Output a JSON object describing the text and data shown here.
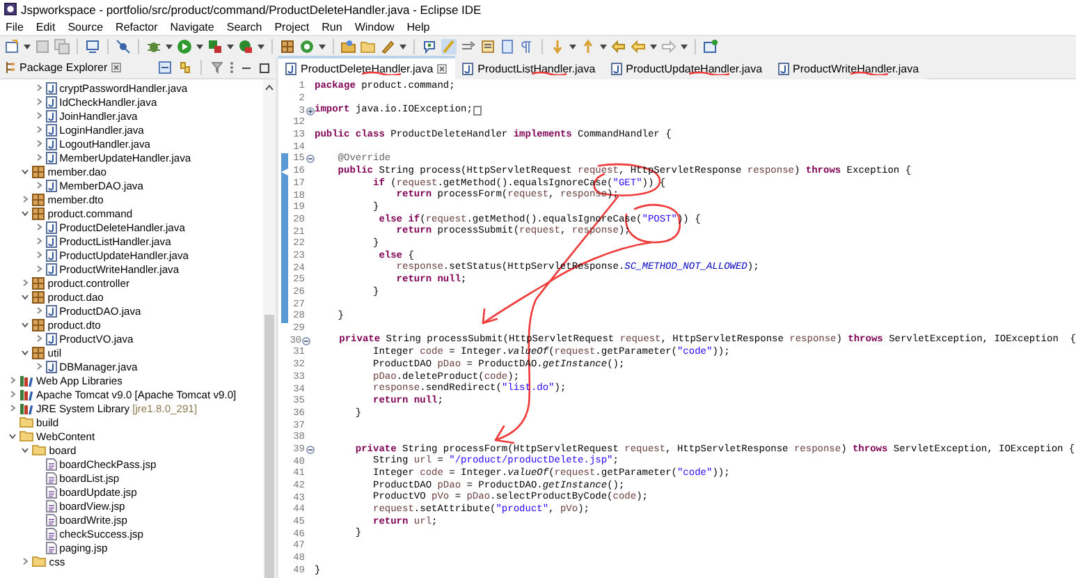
{
  "window": {
    "title": "Jspworkspace - portfolio/src/product/command/ProductDeleteHandler.java - Eclipse IDE"
  },
  "menu": [
    "File",
    "Edit",
    "Source",
    "Refactor",
    "Navigate",
    "Search",
    "Project",
    "Run",
    "Window",
    "Help"
  ],
  "explorer": {
    "title": "Package Explorer",
    "tree": [
      {
        "children": [
          {
            "children": [
              {
                "label": "cryptPasswordHandler.java",
                "kind": "java",
                "expanded": false
              },
              {
                "label": "IdCheckHandler.java",
                "kind": "java",
                "expanded": false
              },
              {
                "label": "JoinHandler.java",
                "kind": "java",
                "expanded": false
              },
              {
                "label": "LoginHandler.java",
                "kind": "java",
                "expanded": false
              },
              {
                "label": "LogoutHandler.java",
                "kind": "java",
                "expanded": false
              },
              {
                "label": "MemberUpdateHandler.java",
                "kind": "java",
                "expanded": false
              }
            ]
          },
          {
            "label": "member.dao",
            "kind": "package",
            "expanded": true,
            "children": [
              {
                "label": "MemberDAO.java",
                "kind": "java",
                "expanded": false
              }
            ]
          },
          {
            "label": "member.dto",
            "kind": "package",
            "expanded": false
          },
          {
            "label": "product.command",
            "kind": "package",
            "expanded": true,
            "children": [
              {
                "label": "ProductDeleteHandler.java",
                "kind": "java",
                "expanded": false
              },
              {
                "label": "ProductListHandler.java",
                "kind": "java",
                "expanded": false
              },
              {
                "label": "ProductUpdateHandler.java",
                "kind": "java",
                "expanded": false
              },
              {
                "label": "ProductWriteHandler.java",
                "kind": "java",
                "expanded": false
              }
            ]
          },
          {
            "label": "product.controller",
            "kind": "package",
            "expanded": false
          },
          {
            "label": "product.dao",
            "kind": "package",
            "expanded": true,
            "children": [
              {
                "label": "ProductDAO.java",
                "kind": "java",
                "expanded": false
              }
            ]
          },
          {
            "label": "product.dto",
            "kind": "package",
            "expanded": true,
            "children": [
              {
                "label": "ProductVO.java",
                "kind": "java",
                "expanded": false
              }
            ]
          },
          {
            "label": "util",
            "kind": "package",
            "expanded": true,
            "children": [
              {
                "label": "DBManager.java",
                "kind": "java",
                "expanded": false
              }
            ]
          }
        ]
      },
      {
        "label": "Web App Libraries",
        "kind": "library",
        "expanded": false
      },
      {
        "label": "Apache Tomcat v9.0 [Apache Tomcat v9.0]",
        "kind": "library",
        "expanded": false
      },
      {
        "label": "JRE System Library",
        "decoration": "[jre1.8.0_291]",
        "kind": "library",
        "expanded": false
      },
      {
        "label": "build",
        "kind": "folder"
      },
      {
        "label": "WebContent",
        "kind": "folder",
        "expanded": true,
        "children": [
          {
            "label": "board",
            "kind": "folder",
            "expanded": true,
            "children": [
              {
                "label": "boardCheckPass.jsp",
                "kind": "jsp"
              },
              {
                "label": "boardList.jsp",
                "kind": "jsp"
              },
              {
                "label": "boardUpdate.jsp",
                "kind": "jsp"
              },
              {
                "label": "boardView.jsp",
                "kind": "jsp"
              },
              {
                "label": "boardWrite.jsp",
                "kind": "jsp"
              },
              {
                "label": "checkSuccess.jsp",
                "kind": "jsp"
              },
              {
                "label": "paging.jsp",
                "kind": "jsp"
              }
            ]
          },
          {
            "label": "css",
            "kind": "folder",
            "expanded": false
          }
        ]
      }
    ]
  },
  "editor": {
    "tabs": [
      {
        "label": "ProductDeleteHandler.java",
        "selected": true
      },
      {
        "label": "ProductListHandler.java",
        "selected": false
      },
      {
        "label": "ProductUpdateHandler.java",
        "selected": false
      },
      {
        "label": "ProductWriteHandler.java",
        "selected": false
      }
    ],
    "lines": [
      {
        "n": "1",
        "kind": "plain",
        "marked": false,
        "tokens": [
          {
            "kind": "keyword",
            "text": "package"
          },
          {
            "kind": "plain",
            "text": " product.command;"
          }
        ]
      },
      {
        "n": "2",
        "kind": "plain",
        "marked": false
      },
      {
        "n": "3",
        "kind": "folded",
        "marked": false,
        "tokens": [
          {
            "kind": "keyword",
            "text": "import"
          },
          {
            "kind": "plain",
            "text": " java.io.IOException;"
          }
        ]
      },
      {
        "n": "12",
        "kind": "plain",
        "marked": false
      },
      {
        "n": "13",
        "kind": "plain",
        "marked": false,
        "tokens": [
          {
            "kind": "keyword",
            "text": "public class"
          },
          {
            "kind": "plain",
            "text": " ProductDeleteHandler "
          },
          {
            "kind": "keyword",
            "text": "implements"
          },
          {
            "kind": "plain",
            "text": " CommandHandler {"
          }
        ]
      },
      {
        "n": "14",
        "kind": "plain",
        "marked": false
      },
      {
        "n": "15",
        "kind": "foldable",
        "marked": true,
        "tokens": [
          {
            "kind": "annotation",
            "text": "    @Override"
          }
        ]
      },
      {
        "n": "16",
        "kind": "override",
        "marked": true,
        "tokens": [
          {
            "kind": "keyword",
            "text": "    public"
          },
          {
            "kind": "plain",
            "text": " String process(HttpServletRequest "
          },
          {
            "kind": "variable",
            "text": "request"
          },
          {
            "kind": "plain",
            "text": ", HttpServletResponse "
          },
          {
            "kind": "variable",
            "text": "response"
          },
          {
            "kind": "plain",
            "text": ") "
          },
          {
            "kind": "keyword",
            "text": "throws"
          },
          {
            "kind": "plain",
            "text": " Exception {"
          }
        ]
      },
      {
        "n": "17",
        "kind": "plain",
        "marked": true,
        "tokens": [
          {
            "kind": "keyword",
            "text": "          if"
          },
          {
            "kind": "plain",
            "text": " ("
          },
          {
            "kind": "variable",
            "text": "request"
          },
          {
            "kind": "plain",
            "text": ".getMethod().equalsIgnoreCase("
          },
          {
            "kind": "string",
            "text": "\"GET\""
          },
          {
            "kind": "plain",
            "text": ")) {"
          }
        ]
      },
      {
        "n": "18",
        "kind": "plain",
        "marked": true,
        "tokens": [
          {
            "kind": "keyword",
            "text": "              return"
          },
          {
            "kind": "plain",
            "text": " processForm("
          },
          {
            "kind": "variable",
            "text": "request"
          },
          {
            "kind": "plain",
            "text": ", "
          },
          {
            "kind": "variable",
            "text": "response"
          },
          {
            "kind": "plain",
            "text": ");"
          }
        ]
      },
      {
        "n": "19",
        "kind": "plain",
        "marked": true,
        "tokens": [
          {
            "kind": "plain",
            "text": "          }"
          }
        ]
      },
      {
        "n": "20",
        "kind": "plain",
        "marked": true,
        "tokens": [
          {
            "kind": "keyword",
            "text": "           else if"
          },
          {
            "kind": "plain",
            "text": "("
          },
          {
            "kind": "variable",
            "text": "request"
          },
          {
            "kind": "plain",
            "text": ".getMethod().equalsIgnoreCase("
          },
          {
            "kind": "string",
            "text": "\"POST\""
          },
          {
            "kind": "plain",
            "text": ")) {"
          }
        ]
      },
      {
        "n": "21",
        "kind": "plain",
        "marked": true,
        "tokens": [
          {
            "kind": "keyword",
            "text": "              return"
          },
          {
            "kind": "plain",
            "text": " processSubmit("
          },
          {
            "kind": "variable",
            "text": "request"
          },
          {
            "kind": "plain",
            "text": ", "
          },
          {
            "kind": "variable",
            "text": "response"
          },
          {
            "kind": "plain",
            "text": ");"
          }
        ]
      },
      {
        "n": "22",
        "kind": "plain",
        "marked": true,
        "tokens": [
          {
            "kind": "plain",
            "text": "          }"
          }
        ]
      },
      {
        "n": "23",
        "kind": "plain",
        "marked": true,
        "tokens": [
          {
            "kind": "keyword",
            "text": "           else"
          },
          {
            "kind": "plain",
            "text": " {"
          }
        ]
      },
      {
        "n": "24",
        "kind": "plain",
        "marked": true,
        "tokens": [
          {
            "kind": "variable",
            "text": "              response"
          },
          {
            "kind": "plain",
            "text": ".setStatus(HttpServletResponse."
          },
          {
            "kind": "constant",
            "text": "SC_METHOD_NOT_ALLOWED"
          },
          {
            "kind": "plain",
            "text": ");"
          }
        ]
      },
      {
        "n": "25",
        "kind": "plain",
        "marked": true,
        "tokens": [
          {
            "kind": "keyword",
            "text": "              return null"
          },
          {
            "kind": "plain",
            "text": ";"
          }
        ]
      },
      {
        "n": "26",
        "kind": "plain",
        "marked": true,
        "tokens": [
          {
            "kind": "plain",
            "text": "          }"
          }
        ]
      },
      {
        "n": "27",
        "kind": "plain",
        "marked": true
      },
      {
        "n": "28",
        "kind": "plain",
        "marked": true,
        "tokens": [
          {
            "kind": "plain",
            "text": "    }"
          }
        ]
      },
      {
        "n": "29",
        "kind": "plain",
        "marked": false
      },
      {
        "n": "30",
        "kind": "foldable",
        "marked": false,
        "tokens": [
          {
            "kind": "keyword",
            "text": "     private"
          },
          {
            "kind": "plain",
            "text": " String processSubmit(HttpServletRequest "
          },
          {
            "kind": "variable",
            "text": "request"
          },
          {
            "kind": "plain",
            "text": ", HttpServletResponse "
          },
          {
            "kind": "variable",
            "text": "response"
          },
          {
            "kind": "plain",
            "text": ") "
          },
          {
            "kind": "keyword",
            "text": "throws"
          },
          {
            "kind": "plain",
            "text": " ServletException, IOException  {"
          }
        ]
      },
      {
        "n": "31",
        "kind": "plain",
        "marked": false,
        "tokens": [
          {
            "kind": "plain",
            "text": "          Integer "
          },
          {
            "kind": "variable",
            "text": "code"
          },
          {
            "kind": "plain",
            "text": " = Integer."
          },
          {
            "kind": "static-method",
            "text": "valueOf"
          },
          {
            "kind": "plain",
            "text": "("
          },
          {
            "kind": "variable",
            "text": "request"
          },
          {
            "kind": "plain",
            "text": ".getParameter("
          },
          {
            "kind": "string",
            "text": "\"code\""
          },
          {
            "kind": "plain",
            "text": "));"
          }
        ]
      },
      {
        "n": "32",
        "kind": "plain",
        "marked": false,
        "tokens": [
          {
            "kind": "plain",
            "text": "          ProductDAO "
          },
          {
            "kind": "variable",
            "text": "pDao"
          },
          {
            "kind": "plain",
            "text": " = ProductDAO."
          },
          {
            "kind": "static-method",
            "text": "getInstance"
          },
          {
            "kind": "plain",
            "text": "();"
          }
        ]
      },
      {
        "n": "33",
        "kind": "plain",
        "marked": false,
        "tokens": [
          {
            "kind": "variable",
            "text": "          pDao"
          },
          {
            "kind": "plain",
            "text": ".deleteProduct("
          },
          {
            "kind": "variable",
            "text": "code"
          },
          {
            "kind": "plain",
            "text": ");"
          }
        ]
      },
      {
        "n": "34",
        "kind": "plain",
        "marked": false,
        "tokens": [
          {
            "kind": "variable",
            "text": "          response"
          },
          {
            "kind": "plain",
            "text": ".sendRedirect("
          },
          {
            "kind": "string",
            "text": "\"list.do\""
          },
          {
            "kind": "plain",
            "text": ");"
          }
        ]
      },
      {
        "n": "35",
        "kind": "plain",
        "marked": false,
        "tokens": [
          {
            "kind": "keyword",
            "text": "          return null"
          },
          {
            "kind": "plain",
            "text": ";"
          }
        ]
      },
      {
        "n": "36",
        "kind": "plain",
        "marked": false,
        "tokens": [
          {
            "kind": "plain",
            "text": "       }"
          }
        ]
      },
      {
        "n": "37",
        "kind": "plain",
        "marked": false
      },
      {
        "n": "38",
        "kind": "plain",
        "marked": false
      },
      {
        "n": "39",
        "kind": "foldable",
        "marked": false,
        "tokens": [
          {
            "kind": "keyword",
            "text": "       private"
          },
          {
            "kind": "plain",
            "text": " String processForm(HttpServletRequest "
          },
          {
            "kind": "variable",
            "text": "request"
          },
          {
            "kind": "plain",
            "text": ", HttpServletResponse "
          },
          {
            "kind": "variable",
            "text": "response"
          },
          {
            "kind": "plain",
            "text": ") "
          },
          {
            "kind": "keyword",
            "text": "throws"
          },
          {
            "kind": "plain",
            "text": " ServletException, IOException {"
          }
        ]
      },
      {
        "n": "40",
        "kind": "plain",
        "marked": false,
        "tokens": [
          {
            "kind": "plain",
            "text": "          String "
          },
          {
            "kind": "variable",
            "text": "url"
          },
          {
            "kind": "plain",
            "text": " = "
          },
          {
            "kind": "string",
            "text": "\"/product/productDelete.jsp\""
          },
          {
            "kind": "plain",
            "text": ";"
          }
        ]
      },
      {
        "n": "41",
        "kind": "plain",
        "marked": false,
        "tokens": [
          {
            "kind": "plain",
            "text": "          Integer "
          },
          {
            "kind": "variable",
            "text": "code"
          },
          {
            "kind": "plain",
            "text": " = Integer."
          },
          {
            "kind": "static-method",
            "text": "valueOf"
          },
          {
            "kind": "plain",
            "text": "("
          },
          {
            "kind": "variable",
            "text": "request"
          },
          {
            "kind": "plain",
            "text": ".getParameter("
          },
          {
            "kind": "string",
            "text": "\"code\""
          },
          {
            "kind": "plain",
            "text": "));"
          }
        ]
      },
      {
        "n": "42",
        "kind": "plain",
        "marked": false,
        "tokens": [
          {
            "kind": "plain",
            "text": "          ProductDAO "
          },
          {
            "kind": "variable",
            "text": "pDao"
          },
          {
            "kind": "plain",
            "text": " = ProductDAO."
          },
          {
            "kind": "static-method",
            "text": "getInstance"
          },
          {
            "kind": "plain",
            "text": "();"
          }
        ]
      },
      {
        "n": "43",
        "kind": "plain",
        "marked": false,
        "tokens": [
          {
            "kind": "plain",
            "text": "          ProductVO "
          },
          {
            "kind": "variable",
            "text": "pVo"
          },
          {
            "kind": "plain",
            "text": " = "
          },
          {
            "kind": "variable",
            "text": "pDao"
          },
          {
            "kind": "plain",
            "text": ".selectProductByCode("
          },
          {
            "kind": "variable",
            "text": "code"
          },
          {
            "kind": "plain",
            "text": ");"
          }
        ]
      },
      {
        "n": "44",
        "kind": "plain",
        "marked": false,
        "tokens": [
          {
            "kind": "variable",
            "text": "          request"
          },
          {
            "kind": "plain",
            "text": ".setAttribute("
          },
          {
            "kind": "string",
            "text": "\"product\""
          },
          {
            "kind": "plain",
            "text": ", "
          },
          {
            "kind": "variable",
            "text": "pVo"
          },
          {
            "kind": "plain",
            "text": ");"
          }
        ]
      },
      {
        "n": "45",
        "kind": "plain",
        "marked": false,
        "tokens": [
          {
            "kind": "keyword",
            "text": "          return "
          },
          {
            "kind": "variable",
            "text": "url"
          },
          {
            "kind": "plain",
            "text": ";"
          }
        ]
      },
      {
        "n": "46",
        "kind": "plain",
        "marked": false,
        "tokens": [
          {
            "kind": "plain",
            "text": "       }"
          }
        ]
      },
      {
        "n": "47",
        "kind": "plain",
        "marked": false
      },
      {
        "n": "48",
        "kind": "plain",
        "marked": false
      },
      {
        "n": "49",
        "kind": "plain",
        "marked": false,
        "tokens": [
          {
            "kind": "plain",
            "text": "}"
          }
        ]
      }
    ]
  }
}
